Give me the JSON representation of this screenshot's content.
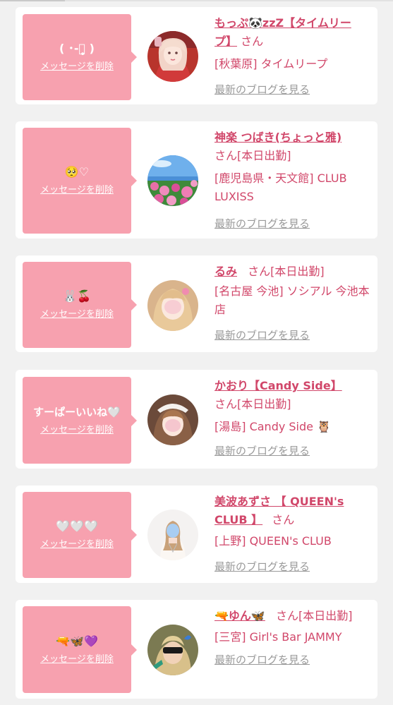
{
  "colors": {
    "bubble": "#f7a1af",
    "name": "#d1476a",
    "blog": "#9a9a9a",
    "card": "#ffffff",
    "background": "#f1f1f1"
  },
  "cards": [
    {
      "message": "( ･-･̥̥̥ )",
      "delete_label": "メッセージを削除",
      "name": "もっぷ🐼zzZ【タイムリープ】",
      "san": "さん",
      "shop": "[秋葉原] タイムリープ",
      "blog": "最新のブログを見る",
      "avatar_icon": "girl-red-kimono-avatar"
    },
    {
      "message": "🥺♡",
      "delete_label": "メッセージを削除",
      "name": "神楽 つばき(ちょっと雅)",
      "san": "さん[本日出勤]",
      "shop": "[鹿児島県・天文館] CLUB LUXISS",
      "blog": "最新のブログを見る",
      "avatar_icon": "flower-field-avatar"
    },
    {
      "message": "🐰🍒",
      "delete_label": "メッセージを削除",
      "name": "るみ",
      "san": "さん[本日出勤]",
      "shop": "[名古屋 今池] ソシアル 今池本店",
      "blog": "最新のブログを見る",
      "avatar_icon": "blonde-girl-avatar"
    },
    {
      "message": "すーぱーいいね🤍",
      "delete_label": "メッセージを削除",
      "name": "かおり【Candy Side】",
      "san": "さん[本日出勤]",
      "shop": "[湯島] Candy Side 🦉",
      "blog": "最新のブログを見る",
      "avatar_icon": "maid-girl-avatar"
    },
    {
      "message": "🤍🤍🤍",
      "delete_label": "メッセージを削除",
      "name": "美波あずさ 【 QUEEN's CLUB 】",
      "san": "さん",
      "shop": "[上野] QUEEN's CLUB",
      "blog": "最新のブログを見る",
      "avatar_icon": "white-dress-girl-avatar"
    },
    {
      "message": "🔫🦋💜",
      "delete_label": "メッセージを削除",
      "name": "🔫ゆん🦋",
      "san": "さん[本日出勤]",
      "shop": "[三宮] Girl's Bar JAMMY",
      "blog": "最新のブログを見る",
      "avatar_icon": "sunglasses-girl-avatar"
    }
  ]
}
